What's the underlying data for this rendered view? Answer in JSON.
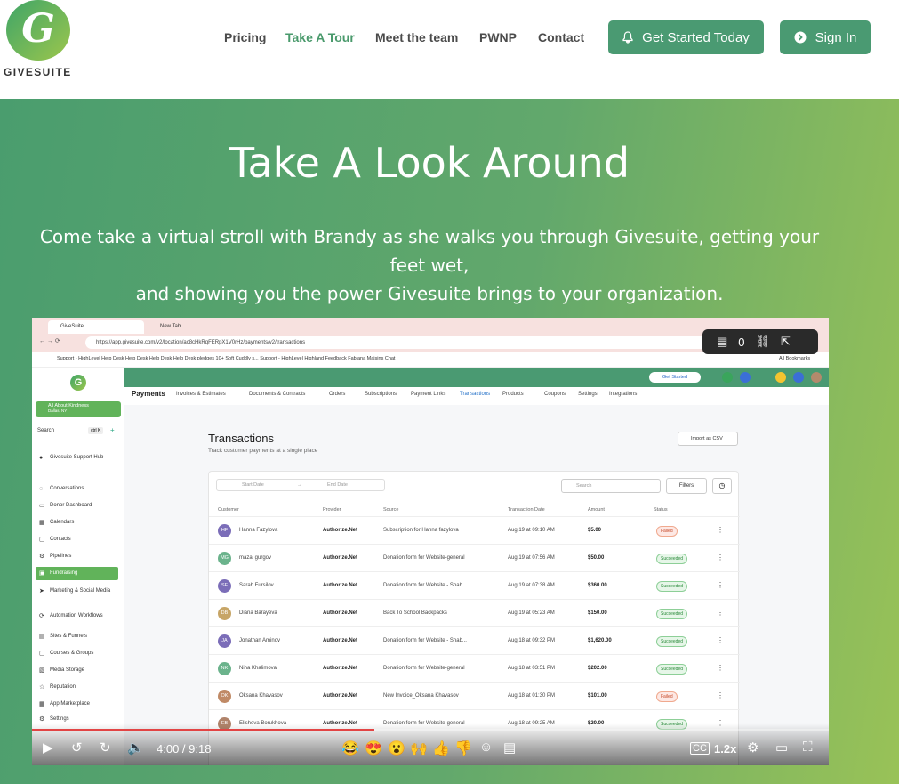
{
  "brand": {
    "logo_letter": "G",
    "name": "GIVESUITE"
  },
  "nav": {
    "items": [
      "Pricing",
      "Take A Tour",
      "Meet the team",
      "PWNP",
      "Contact"
    ],
    "active": "Take A Tour"
  },
  "cta": {
    "get_started": "Get Started Today",
    "sign_in": "Sign In"
  },
  "hero": {
    "title": "Take A Look Around",
    "subtitle_line1": "Come take a virtual stroll with Brandy as she walks you through Givesuite, getting your feet wet,",
    "subtitle_line2": "and showing you the power Givesuite brings to your organization."
  },
  "video": {
    "browser": {
      "tab1": "GiveSuite",
      "tab2": "New Tab",
      "url": "https://app.givesuite.com/v2/location/ac8cHkRqFERpX1V0rHz/payments/v2/transactions",
      "bookmarks": "Support - HighLevel   Help Desk   Help Desk   Help Desk   Help Desk   pledges   10+ Soft Cuddly s...   Support - HighLevel   Highland Feedback   Fabiana Maisins   Chat",
      "all_bookmarks": "All Bookmarks"
    },
    "overlay": {
      "comments": "0"
    },
    "sidebar": {
      "account": "All About Kindness",
      "account_sub": "Dallas, NY",
      "search": "Search",
      "search_kbd": "ctrl K",
      "items": [
        "Givesuite Support Hub",
        "Conversations",
        "Donor Dashboard",
        "Calendars",
        "Contacts",
        "Pipelines",
        "Fundraising",
        "Marketing & Social Media",
        "Automation Workflows",
        "Sites & Funnels",
        "Courses & Groups",
        "Media Storage",
        "Reputation",
        "App Marketplace",
        "Settings"
      ],
      "active": "Fundraising"
    },
    "topbar": {
      "get_started": "Get Started"
    },
    "tabs": [
      "Payments",
      "Invoices & Estimates",
      "Documents & Contracts",
      "Orders",
      "Subscriptions",
      "Payment Links",
      "Transactions",
      "Products",
      "Coupons",
      "Settings",
      "Integrations"
    ],
    "tabs_active": "Transactions",
    "page": {
      "title": "Transactions",
      "subtitle": "Track customer payments at a single place",
      "import_csv": "Import as CSV"
    },
    "filters": {
      "start_date": "Start Date",
      "end_date": "End Date",
      "search": "Search",
      "filters": "Filters"
    },
    "columns": [
      "Customer",
      "Provider",
      "Source",
      "Transaction Date",
      "Amount",
      "Status"
    ],
    "rows": [
      {
        "initials": "HF",
        "name": "Hanna Fazylova",
        "provider": "Authorize.Net",
        "source": "Subscription for Hanna fazylova",
        "date": "Aug 19 at 09:10 AM",
        "amount": "$5.00",
        "status": "Failed",
        "color": "#7b6db8"
      },
      {
        "initials": "MG",
        "name": "mazal gurgov",
        "provider": "Authorize.Net",
        "source": "Donation form for Website-general",
        "date": "Aug 19 at 07:56 AM",
        "amount": "$50.00",
        "status": "Succeeded",
        "color": "#6bb38c"
      },
      {
        "initials": "SF",
        "name": "Sarah Fursilov",
        "provider": "Authorize.Net",
        "source": "Donation form for Website - Shab...",
        "date": "Aug 19 at 07:38 AM",
        "amount": "$360.00",
        "status": "Succeeded",
        "color": "#7b6db8"
      },
      {
        "initials": "DB",
        "name": "Diana Barayeva",
        "provider": "Authorize.Net",
        "source": "Back To School Backpacks",
        "date": "Aug 19 at 05:23 AM",
        "amount": "$150.00",
        "status": "Succeeded",
        "color": "#c7a566"
      },
      {
        "initials": "JA",
        "name": "Jonathan Aminov",
        "provider": "Authorize.Net",
        "source": "Donation form for Website - Shab...",
        "date": "Aug 18 at 09:32 PM",
        "amount": "$1,620.00",
        "status": "Succeeded",
        "color": "#7b6db8"
      },
      {
        "initials": "NK",
        "name": "Nina Khalimova",
        "provider": "Authorize.Net",
        "source": "Donation form for Website-general",
        "date": "Aug 18 at 03:51 PM",
        "amount": "$202.00",
        "status": "Succeeded",
        "color": "#6bb38c"
      },
      {
        "initials": "OK",
        "name": "Oksana Khavasov",
        "provider": "Authorize.Net",
        "source": "New Invoice_Oksana Khavasov",
        "date": "Aug 18 at 01:30 PM",
        "amount": "$101.00",
        "status": "Failed",
        "color": "#c08a66"
      },
      {
        "initials": "EB",
        "name": "Elisheva Borukhova",
        "provider": "Authorize.Net",
        "source": "Donation form for Website-general",
        "date": "Aug 18 at 09:25 AM",
        "amount": "$20.00",
        "status": "Succeeded",
        "color": "#b0836a"
      }
    ],
    "player": {
      "time": "4:00 / 9:18",
      "speed": "1.2x",
      "progress": 0.43
    }
  },
  "colors": {
    "brand_green": "#4a9a72",
    "hero_start": "#4a9d6e",
    "hero_end": "#99c257",
    "active_nav": "#4a9a6c"
  }
}
